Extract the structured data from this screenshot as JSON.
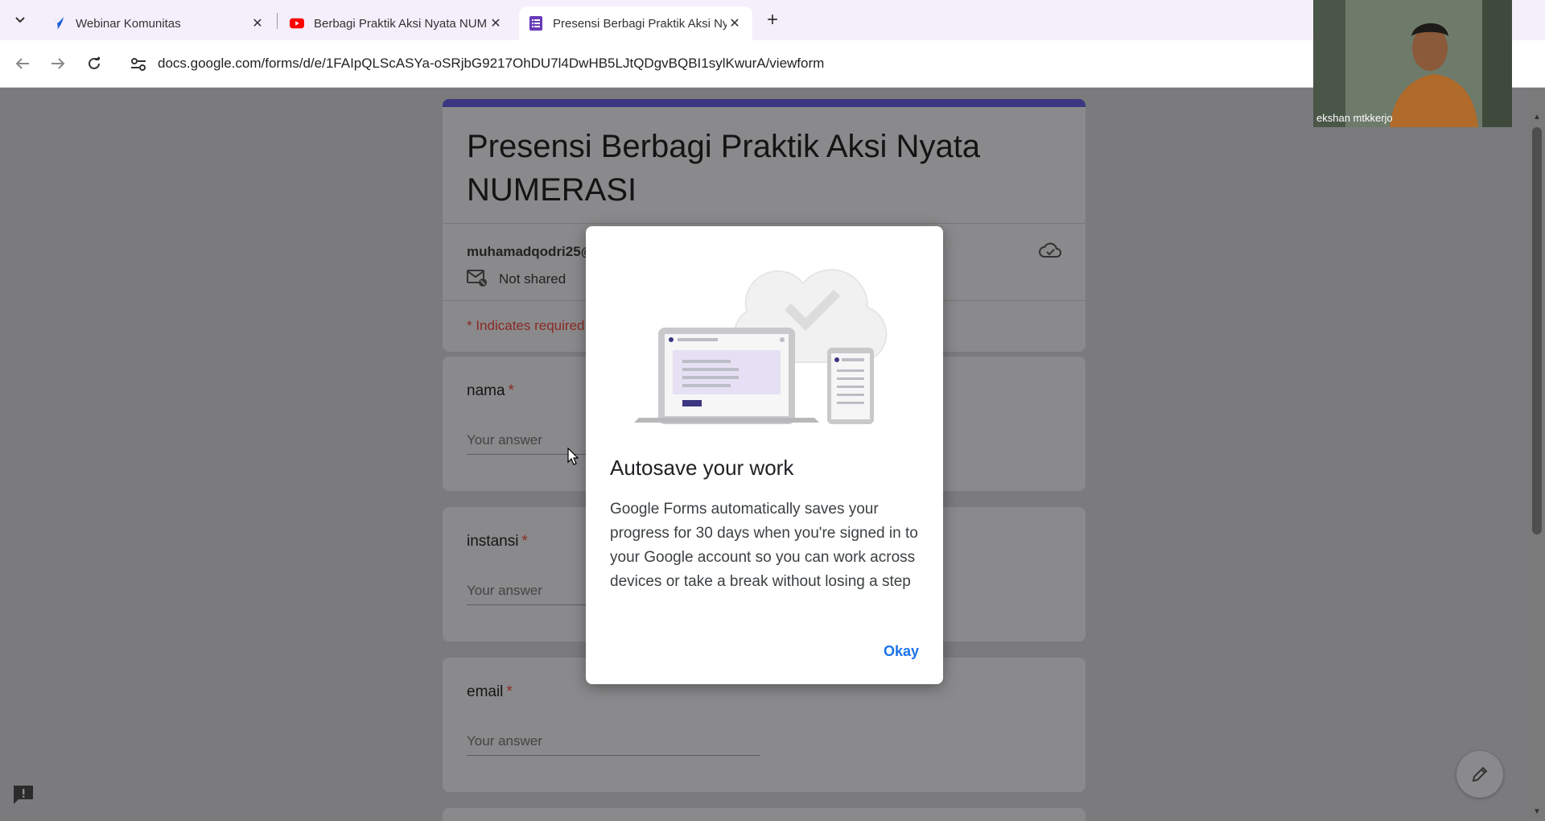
{
  "browser": {
    "tabs": [
      {
        "title": "Webinar Komunitas",
        "favicon": "guru-icon"
      },
      {
        "title": "Berbagi Praktik Aksi Nyata NUMERASI",
        "favicon": "youtube-icon"
      },
      {
        "title": "Presensi Berbagi Praktik Aksi Nyata NUMERASI",
        "favicon": "forms-icon",
        "active": true
      }
    ],
    "url": "docs.google.com/forms/d/e/1FAIpQLScASYa-oSRjbG9217OhDU7l4DwHB5LJtQDgvBQBI1sylKwurA/viewform"
  },
  "form": {
    "title": "Presensi Berbagi Praktik Aksi Nyata NUMERASI",
    "account": "muhamadqodri25@",
    "sharing": "Not shared",
    "required_note": "* Indicates required",
    "questions": [
      {
        "label": "nama",
        "placeholder": "Your answer",
        "required_mark": "*"
      },
      {
        "label": "instansi",
        "placeholder": "Your answer",
        "required_mark": "*"
      },
      {
        "label": "email",
        "placeholder": "Your answer",
        "required_mark": "*"
      }
    ]
  },
  "dialog": {
    "title": "Autosave your work",
    "body": "Google Forms automatically saves your progress for 30 days when you're signed in to your Google account so you can work across devices or take a break without losing a step",
    "ok_label": "Okay"
  },
  "video": {
    "caption": "ekshan mtkkerjo"
  },
  "colors": {
    "form_accent": "#3c3780",
    "required": "#d93025",
    "dialog_button": "#1a73e8"
  }
}
